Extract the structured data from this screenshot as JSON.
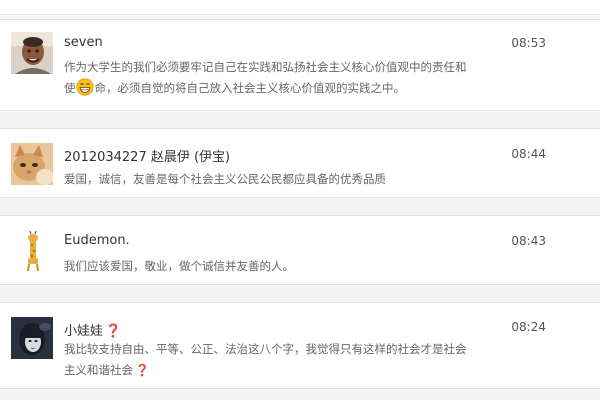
{
  "posts": [
    {
      "name": "seven",
      "time": "08:53",
      "line1": "作为大学生的我们必须要牢记自己在实践和弘扬社会主义核心价值观中的责任和",
      "line2_prefix": "使",
      "line2_rest": "命，必须自觉的将自己放入社会主义核心价值观的实践之中。",
      "avatar_icon": "man-face-avatar",
      "inline_icon": "grin-emoji-icon"
    },
    {
      "name": "2012034227 赵晨伊 (伊宝)",
      "time": "08:44",
      "line1": "爱国，诚信，友善是每个社会主义公民公民都应具备的优秀品质",
      "avatar_icon": "cat-photo-avatar"
    },
    {
      "name": "Eudemon.",
      "time": "08:43",
      "line1": "我们应该爱国，敬业，做个诚信并友善的人。",
      "avatar_icon": "giraffe-avatar"
    },
    {
      "name": "小娃娃",
      "name_mark": "❓",
      "time": "08:24",
      "line1": "我比较支持自由、平等、公正、法治这八个字，我觉得只有这样的社会才是社会",
      "line2": "主义和谐社会",
      "line2_mark": "❓",
      "avatar_icon": "girl-portrait-avatar"
    }
  ],
  "colors": {
    "background": "#f4f4f4",
    "card": "#ffffff",
    "divider": "#e3e3e3",
    "name": "#333333",
    "body_text": "#666666",
    "time": "#555555",
    "question_mark": "#c0151b"
  }
}
